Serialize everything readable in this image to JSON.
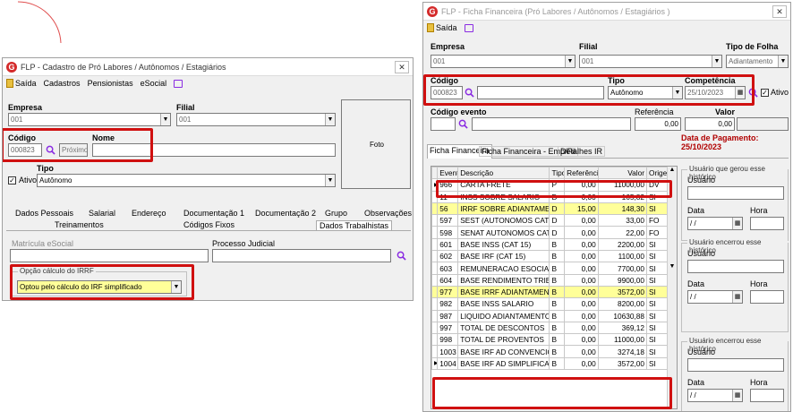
{
  "left": {
    "title": "FLP - Cadastro de Pró Labores / Autônomos / Estagiários",
    "menu": [
      "Saída",
      "Cadastros",
      "Pensionistas",
      "eSocial"
    ],
    "empresa_label": "Empresa",
    "empresa_value": "001",
    "filial_label": "Filial",
    "filial_value": "001",
    "codigo_label": "Código",
    "codigo_value": "000823",
    "nome_label": "Nome",
    "proximo_label": "Próximo",
    "foto_label": "Foto",
    "tipo_label": "Tipo",
    "ativo_label": "Ativo",
    "tipo_value": "Autônomo",
    "tabs_row1": [
      "Dados Pessoais",
      "Salarial",
      "Endereço",
      "Documentação 1",
      "Documentação 2",
      "Grupo",
      "Observações"
    ],
    "tabs_row2": [
      "Treinamentos",
      "Códigos Fixos",
      "Dados Trabalhistas"
    ],
    "matricula_label": "Matrícula eSocial",
    "processo_label": "Processo Judicial",
    "irrf_label": "Opção cálculo do IRRF",
    "irrf_value": "Optou pelo cálculo do IRF simplificado"
  },
  "right": {
    "title": "FLP - Ficha Financeira (Pró Labores / Autônomos / Estagiários )",
    "menu": [
      "Saída"
    ],
    "empresa_label": "Empresa",
    "empresa_value": "001",
    "filial_label": "Filial",
    "filial_value": "001",
    "tipofolha_label": "Tipo de Folha",
    "tipofolha_value": "Adiantamento",
    "codigo_label": "Código",
    "codigo_value": "000823",
    "tipo_label": "Tipo",
    "tipo_value": "Autônomo",
    "competencia_label": "Competência",
    "competencia_value": "25/10/2023",
    "ativo_label": "Ativo",
    "codevento_label": "Código evento",
    "referencia_label": "Referência",
    "referencia_value": "0,00",
    "valor_label": "Valor",
    "valor_value": "0,00",
    "data_pagamento": "Data de Pagamento: 25/10/2023",
    "tabs": [
      "Ficha Financeira",
      "Ficha Financeira - Emp/Fil",
      "Detalhes IR"
    ],
    "columns": [
      "Evento",
      "Descrição",
      "Tipo",
      "Referência",
      "Valor",
      "Origem"
    ],
    "rows": [
      {
        "ev": "966",
        "desc": "CARTA FRETE",
        "tipo": "P",
        "ref": "0,00",
        "val": "11000,00",
        "org": "DV",
        "hl": false
      },
      {
        "ev": "11",
        "desc": "INSS SOBRE SALARIO",
        "tipo": "D",
        "ref": "0,00",
        "val": "165,82",
        "org": "SI",
        "hl": false
      },
      {
        "ev": "56",
        "desc": "IRRF SOBRE ADIANTAMENT",
        "tipo": "D",
        "ref": "15,00",
        "val": "148,30",
        "org": "SI",
        "hl": true
      },
      {
        "ev": "597",
        "desc": "SEST (AUTONOMOS CAT 15",
        "tipo": "D",
        "ref": "0,00",
        "val": "33,00",
        "org": "FO",
        "hl": false
      },
      {
        "ev": "598",
        "desc": "SENAT AUTONOMOS CAT 15",
        "tipo": "D",
        "ref": "0,00",
        "val": "22,00",
        "org": "FO",
        "hl": false
      },
      {
        "ev": "601",
        "desc": "BASE INSS (CAT 15)",
        "tipo": "B",
        "ref": "0,00",
        "val": "2200,00",
        "org": "SI",
        "hl": false
      },
      {
        "ev": "602",
        "desc": "BASE IRF (CAT 15)",
        "tipo": "B",
        "ref": "0,00",
        "val": "1100,00",
        "org": "SI",
        "hl": false
      },
      {
        "ev": "603",
        "desc": "REMUNERACAO ESOCIAL",
        "tipo": "B",
        "ref": "0,00",
        "val": "7700,00",
        "org": "SI",
        "hl": false
      },
      {
        "ev": "604",
        "desc": "BASE RENDIMENTO TRIBUT",
        "tipo": "B",
        "ref": "0,00",
        "val": "9900,00",
        "org": "SI",
        "hl": false
      },
      {
        "ev": "977",
        "desc": "BASE IRRF ADIANTAMENTO",
        "tipo": "B",
        "ref": "0,00",
        "val": "3572,00",
        "org": "SI",
        "hl": true
      },
      {
        "ev": "982",
        "desc": "BASE INSS SALARIO",
        "tipo": "B",
        "ref": "0,00",
        "val": "8200,00",
        "org": "SI",
        "hl": false
      },
      {
        "ev": "987",
        "desc": "LIQUIDO ADIANTAMENTO",
        "tipo": "B",
        "ref": "0,00",
        "val": "10630,88",
        "org": "SI",
        "hl": false
      },
      {
        "ev": "997",
        "desc": "TOTAL DE DESCONTOS",
        "tipo": "B",
        "ref": "0,00",
        "val": "369,12",
        "org": "SI",
        "hl": false
      },
      {
        "ev": "998",
        "desc": "TOTAL DE PROVENTOS",
        "tipo": "B",
        "ref": "0,00",
        "val": "11000,00",
        "org": "SI",
        "hl": false
      },
      {
        "ev": "1003",
        "desc": "BASE IRF AD CONVENCION",
        "tipo": "B",
        "ref": "0,00",
        "val": "3274,18",
        "org": "SI",
        "hl": false
      },
      {
        "ev": "1004",
        "desc": "BASE IRF AD SIMPLIFICA",
        "tipo": "B",
        "ref": "0,00",
        "val": "3572,00",
        "org": "SI",
        "hl": false
      }
    ],
    "side_groups": [
      {
        "title": "Usuário que gerou esse histórico",
        "usuario": "Usuário",
        "data": "Data",
        "hora": "Hora",
        "date_val": "/ /"
      },
      {
        "title": "Usuário encerrou esse histórico",
        "usuario": "Usuário",
        "data": "Data",
        "hora": "Hora",
        "date_val": "/ /"
      },
      {
        "title": "Usuário encerrou esse histórico",
        "usuario": "Usuário",
        "data": "Data",
        "hora": "Hora",
        "date_val": "/ /"
      }
    ]
  },
  "colors": {
    "red": "#d01010",
    "highlight": "#ffff99",
    "accent_purple": "#8a2be2",
    "date_red": "#b00000"
  }
}
